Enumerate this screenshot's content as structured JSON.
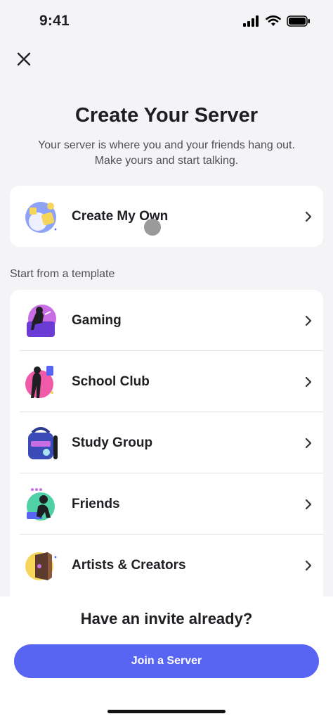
{
  "status": {
    "time": "9:41"
  },
  "header": {
    "title": "Create Your Server",
    "subtitle_line1": "Your server is where you and your friends hang out.",
    "subtitle_line2": "Make yours and start talking."
  },
  "create_own": {
    "label": "Create My Own"
  },
  "templates_heading": "Start from a template",
  "templates": [
    {
      "label": "Gaming",
      "icon": "gaming-icon"
    },
    {
      "label": "School Club",
      "icon": "school-club-icon"
    },
    {
      "label": "Study Group",
      "icon": "study-group-icon"
    },
    {
      "label": "Friends",
      "icon": "friends-icon"
    },
    {
      "label": "Artists & Creators",
      "icon": "artists-creators-icon"
    }
  ],
  "footer": {
    "invite_title": "Have an invite already?",
    "join_label": "Join a Server"
  },
  "colors": {
    "accent": "#5865f2",
    "background": "#f4f4f6"
  }
}
